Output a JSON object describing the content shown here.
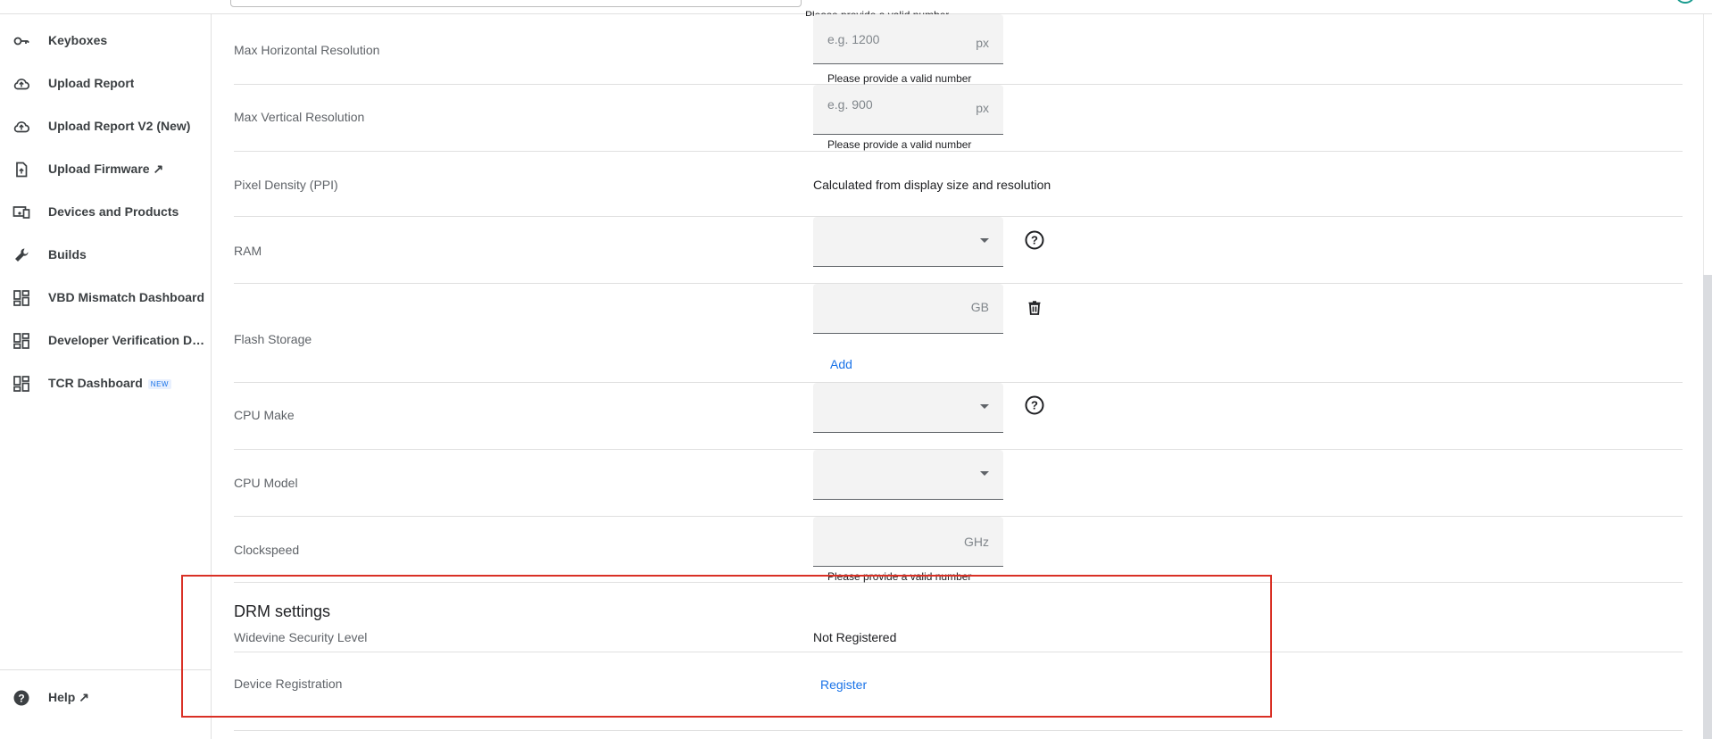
{
  "sidebar": {
    "items": [
      {
        "label": "Keyboxes",
        "icon": "key-icon"
      },
      {
        "label": "Upload Report",
        "icon": "cloud-upload-icon"
      },
      {
        "label": "Upload Report V2 (New)",
        "icon": "cloud-upload-icon"
      },
      {
        "label": "Upload Firmware ↗",
        "icon": "file-upload-icon"
      },
      {
        "label": "Devices and Products",
        "icon": "devices-icon"
      },
      {
        "label": "Builds",
        "icon": "wrench-icon"
      },
      {
        "label": "VBD Mismatch Dashboard",
        "icon": "dashboard-icon"
      },
      {
        "label": "Developer Verification Dashboard",
        "icon": "dashboard-icon"
      },
      {
        "label": "TCR Dashboard",
        "icon": "dashboard-icon",
        "badge": "NEW"
      }
    ],
    "help": {
      "label": "Help ↗",
      "icon": "help-circle-icon"
    }
  },
  "form": {
    "top_hint": "Please provide a valid number",
    "max_h_res": {
      "label": "Max Horizontal Resolution",
      "placeholder": "e.g. 1200",
      "suffix": "px",
      "hint": "Please provide a valid number"
    },
    "max_v_res": {
      "label": "Max Vertical Resolution",
      "placeholder": "e.g. 900",
      "suffix": "px",
      "hint": "Please provide a valid number"
    },
    "ppi": {
      "label": "Pixel Density (PPI)",
      "value": "Calculated from display size and resolution"
    },
    "ram": {
      "label": "RAM",
      "value": ""
    },
    "flash": {
      "label": "Flash Storage",
      "suffix": "GB",
      "add_label": "Add"
    },
    "cpu_make": {
      "label": "CPU Make",
      "value": ""
    },
    "cpu_model": {
      "label": "CPU Model",
      "value": ""
    },
    "clockspeed": {
      "label": "Clockspeed",
      "suffix": "GHz",
      "hint": "Please provide a valid number"
    }
  },
  "drm": {
    "title": "DRM settings",
    "widevine": {
      "label": "Widevine Security Level",
      "value": "Not Registered"
    },
    "registration": {
      "label": "Device Registration",
      "button": "Register"
    }
  },
  "colors": {
    "accent": "#1a73e8",
    "highlight": "#d93025"
  }
}
